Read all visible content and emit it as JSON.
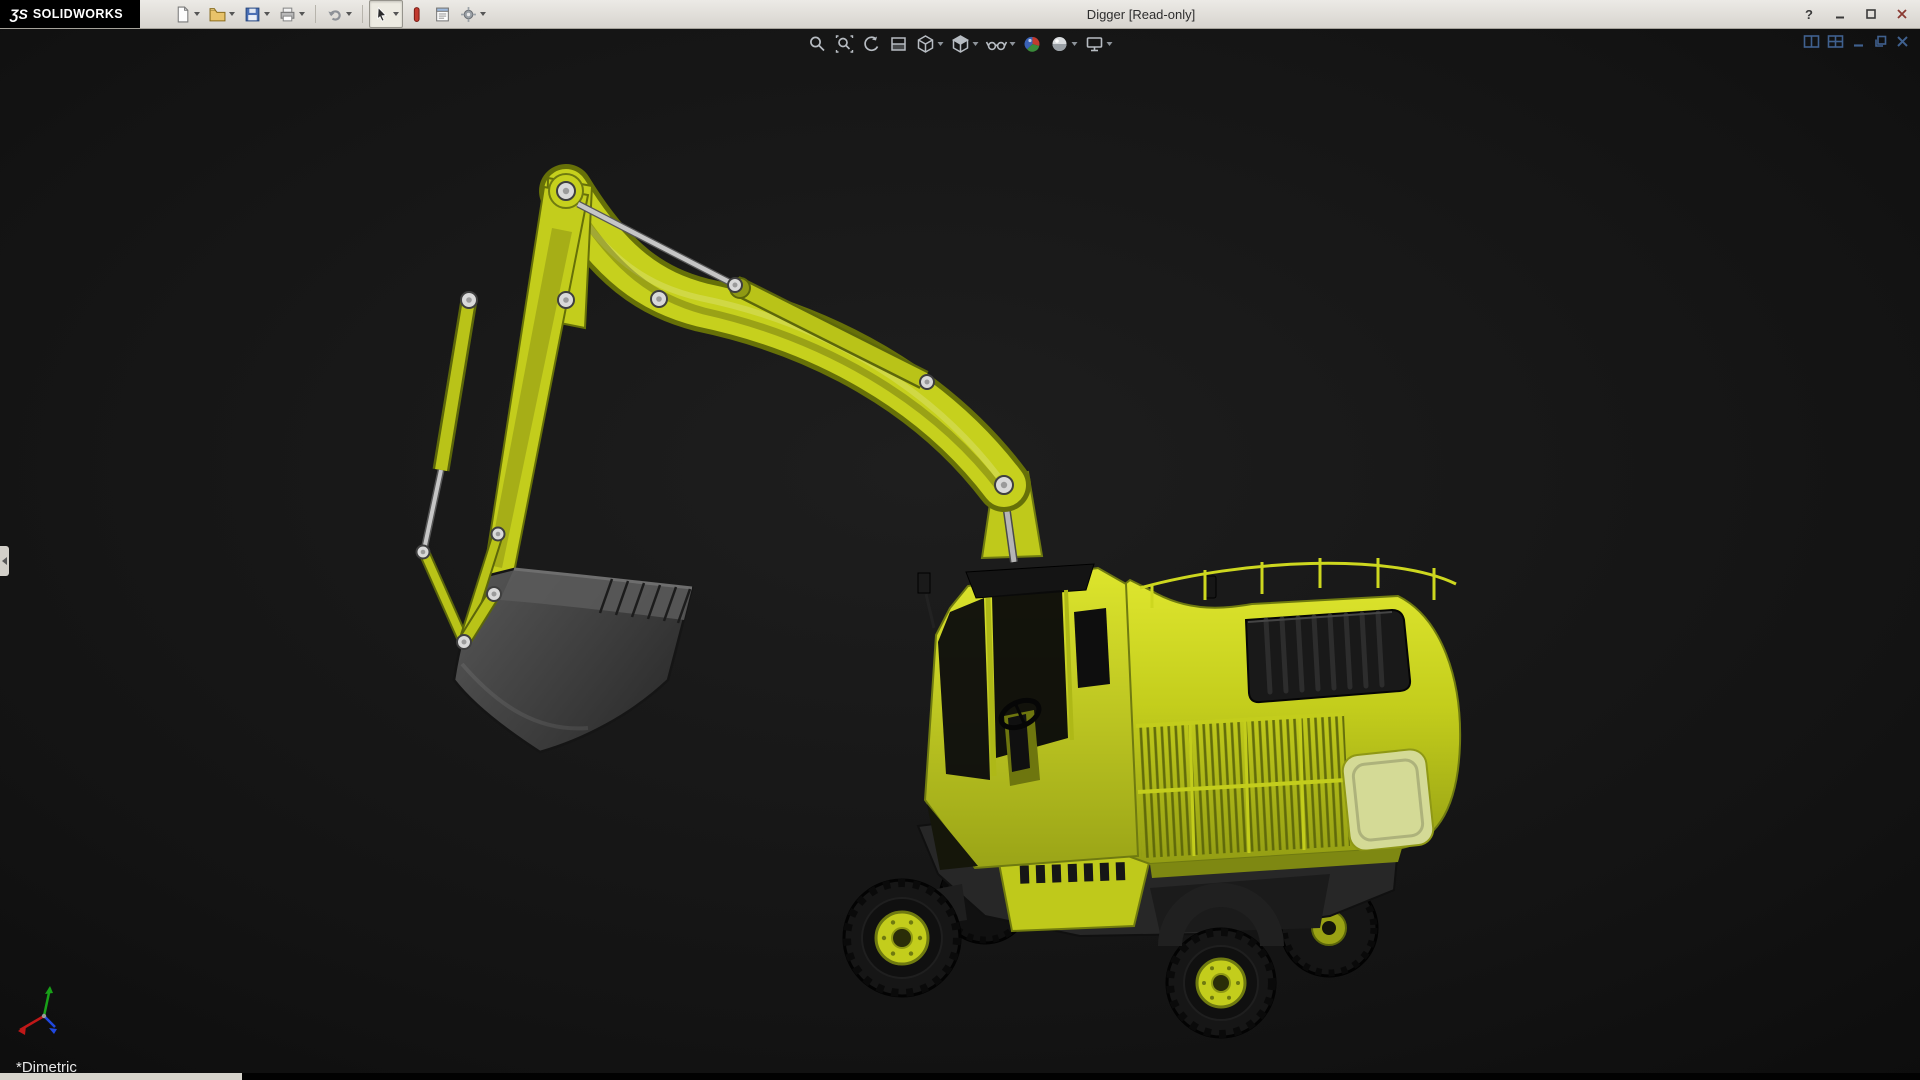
{
  "window": {
    "brand_prefix": "ƷS",
    "brand": "SOLIDWORKS",
    "title": "Digger [Read-only]",
    "controls": [
      {
        "name": "help"
      },
      {
        "name": "minimize"
      },
      {
        "name": "maximize"
      },
      {
        "name": "close"
      }
    ]
  },
  "main_toolbar": {
    "items": [
      {
        "name": "new-document",
        "dropdown": true
      },
      {
        "name": "open",
        "dropdown": true
      },
      {
        "name": "save",
        "dropdown": true
      },
      {
        "name": "print",
        "dropdown": true
      },
      {
        "name": "undo",
        "dropdown": true
      },
      {
        "name": "select",
        "dropdown": true,
        "active": true
      },
      {
        "name": "instant3d",
        "dropdown": false
      },
      {
        "name": "sheet-properties",
        "dropdown": false
      },
      {
        "name": "options",
        "dropdown": true
      }
    ]
  },
  "heads_up_toolbar": {
    "items": [
      {
        "name": "zoom-to-fit",
        "dropdown": false
      },
      {
        "name": "zoom-to-area",
        "dropdown": false
      },
      {
        "name": "previous-view",
        "dropdown": false
      },
      {
        "name": "section-view",
        "dropdown": false
      },
      {
        "name": "view-orientation",
        "dropdown": true
      },
      {
        "name": "display-style",
        "dropdown": true
      },
      {
        "name": "hide-show-items",
        "dropdown": true
      },
      {
        "name": "edit-appearance",
        "dropdown": false
      },
      {
        "name": "apply-scene",
        "dropdown": true
      },
      {
        "name": "view-settings",
        "dropdown": true
      }
    ]
  },
  "document_window_controls": [
    {
      "name": "split-view"
    },
    {
      "name": "four-view"
    },
    {
      "name": "minimize-document"
    },
    {
      "name": "restore-document"
    },
    {
      "name": "close-document"
    }
  ],
  "viewport": {
    "orientation_label": "*Dimetric",
    "model_name": "Digger",
    "background_color": "#141414"
  },
  "model_colors": {
    "body_yellow": "#c3cd1c",
    "shadow_yellow": "#8f9913",
    "bucket_gray": "#3c3c3c",
    "chassis_gray": "#262626",
    "hydraulic_silver": "#c6c6c6",
    "glass_black": "#0d0d0d"
  }
}
